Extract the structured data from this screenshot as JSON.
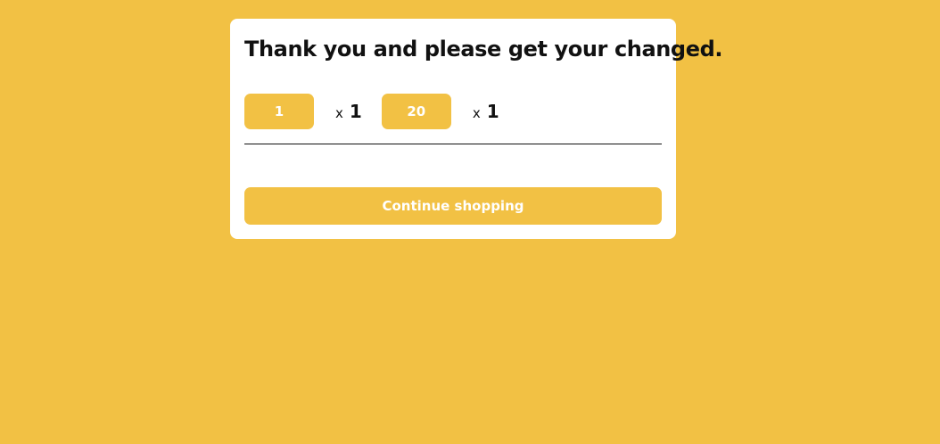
{
  "dialog": {
    "title": "Thank you and please get your changed.",
    "change_items": [
      {
        "denomination": "1",
        "multiplier": "x",
        "quantity": "1"
      },
      {
        "denomination": "20",
        "multiplier": "x",
        "quantity": "1"
      }
    ],
    "continue_label": "Continue shopping"
  },
  "colors": {
    "accent": "#F2C144",
    "background": "#F2C144",
    "card": "#FFFFFF",
    "text": "#111111"
  }
}
